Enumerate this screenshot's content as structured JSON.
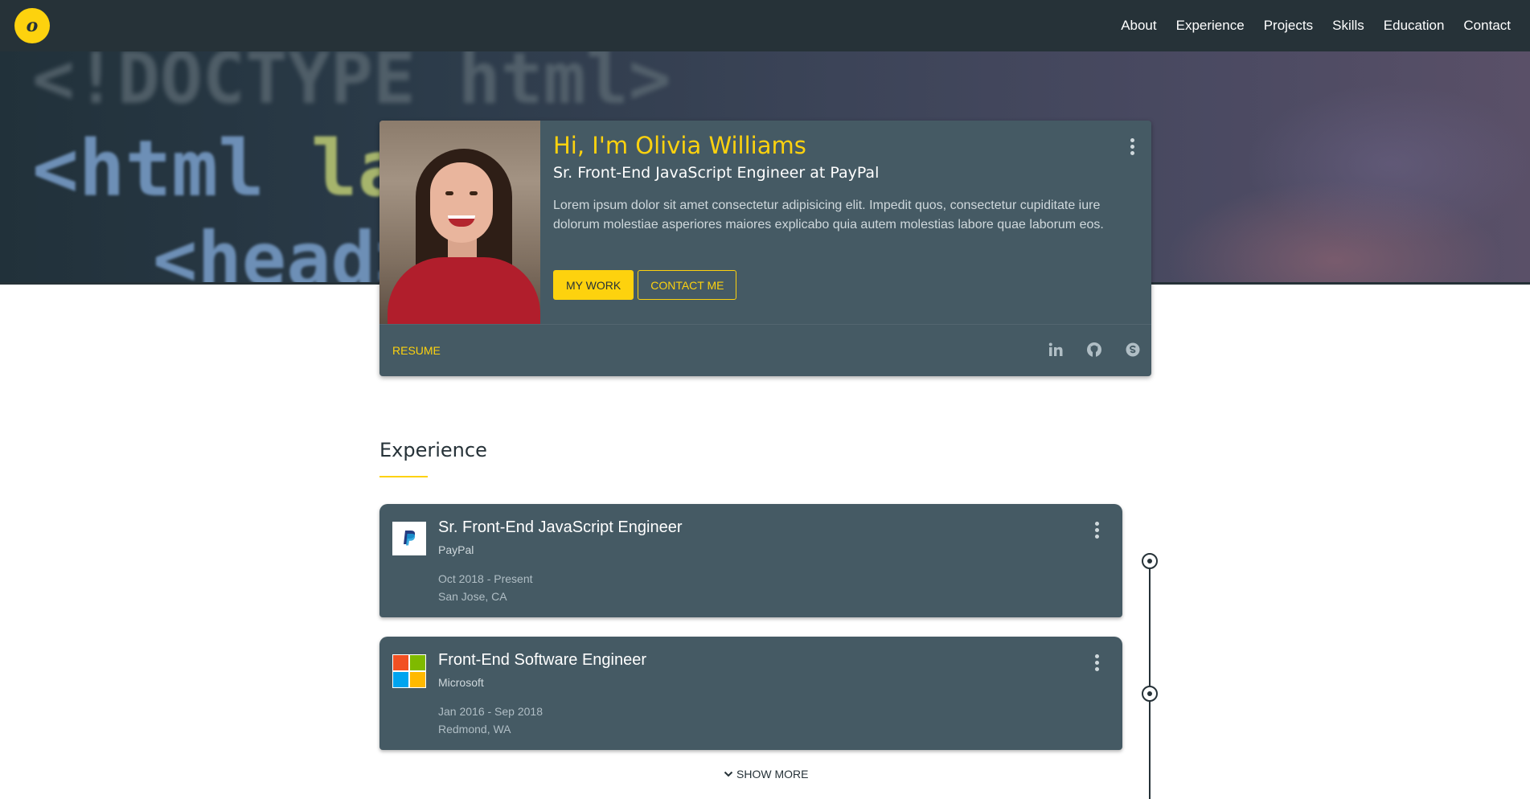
{
  "nav": {
    "logo_letter": "o",
    "items": [
      "About",
      "Experience",
      "Projects",
      "Skills",
      "Education",
      "Contact"
    ]
  },
  "hero": {
    "code_lines": [
      "<!DOCTYPE html>",
      "<html",
      "lan",
      "<head>"
    ]
  },
  "profile": {
    "greeting": "Hi, I'm Olivia Williams",
    "role": "Sr. Front-End JavaScript Engineer at PayPal",
    "bio": "Lorem ipsum dolor sit amet consectetur adipisicing elit. Impedit quos, consectetur cupiditate iure dolorum molestiae asperiores maiores explicabo quia autem molestias labore quae laborum eos.",
    "primary_button": "MY WORK",
    "secondary_button": "CONTACT ME",
    "resume_link": "RESUME",
    "social_icons": [
      "linkedin-icon",
      "github-icon",
      "skype-icon"
    ]
  },
  "experience": {
    "heading": "Experience",
    "jobs": [
      {
        "title": "Sr. Front-End JavaScript Engineer",
        "company": "PayPal",
        "dates": "Oct 2018 - Present",
        "location": "San Jose, CA",
        "logo": "paypal-logo"
      },
      {
        "title": "Front-End Software Engineer",
        "company": "Microsoft",
        "dates": "Jan 2016 - Sep 2018",
        "location": "Redmond, WA",
        "logo": "microsoft-logo"
      }
    ],
    "show_more": "SHOW MORE"
  },
  "colors": {
    "accent": "#fdd20e",
    "card": "#455a64",
    "nav": "#263238"
  }
}
